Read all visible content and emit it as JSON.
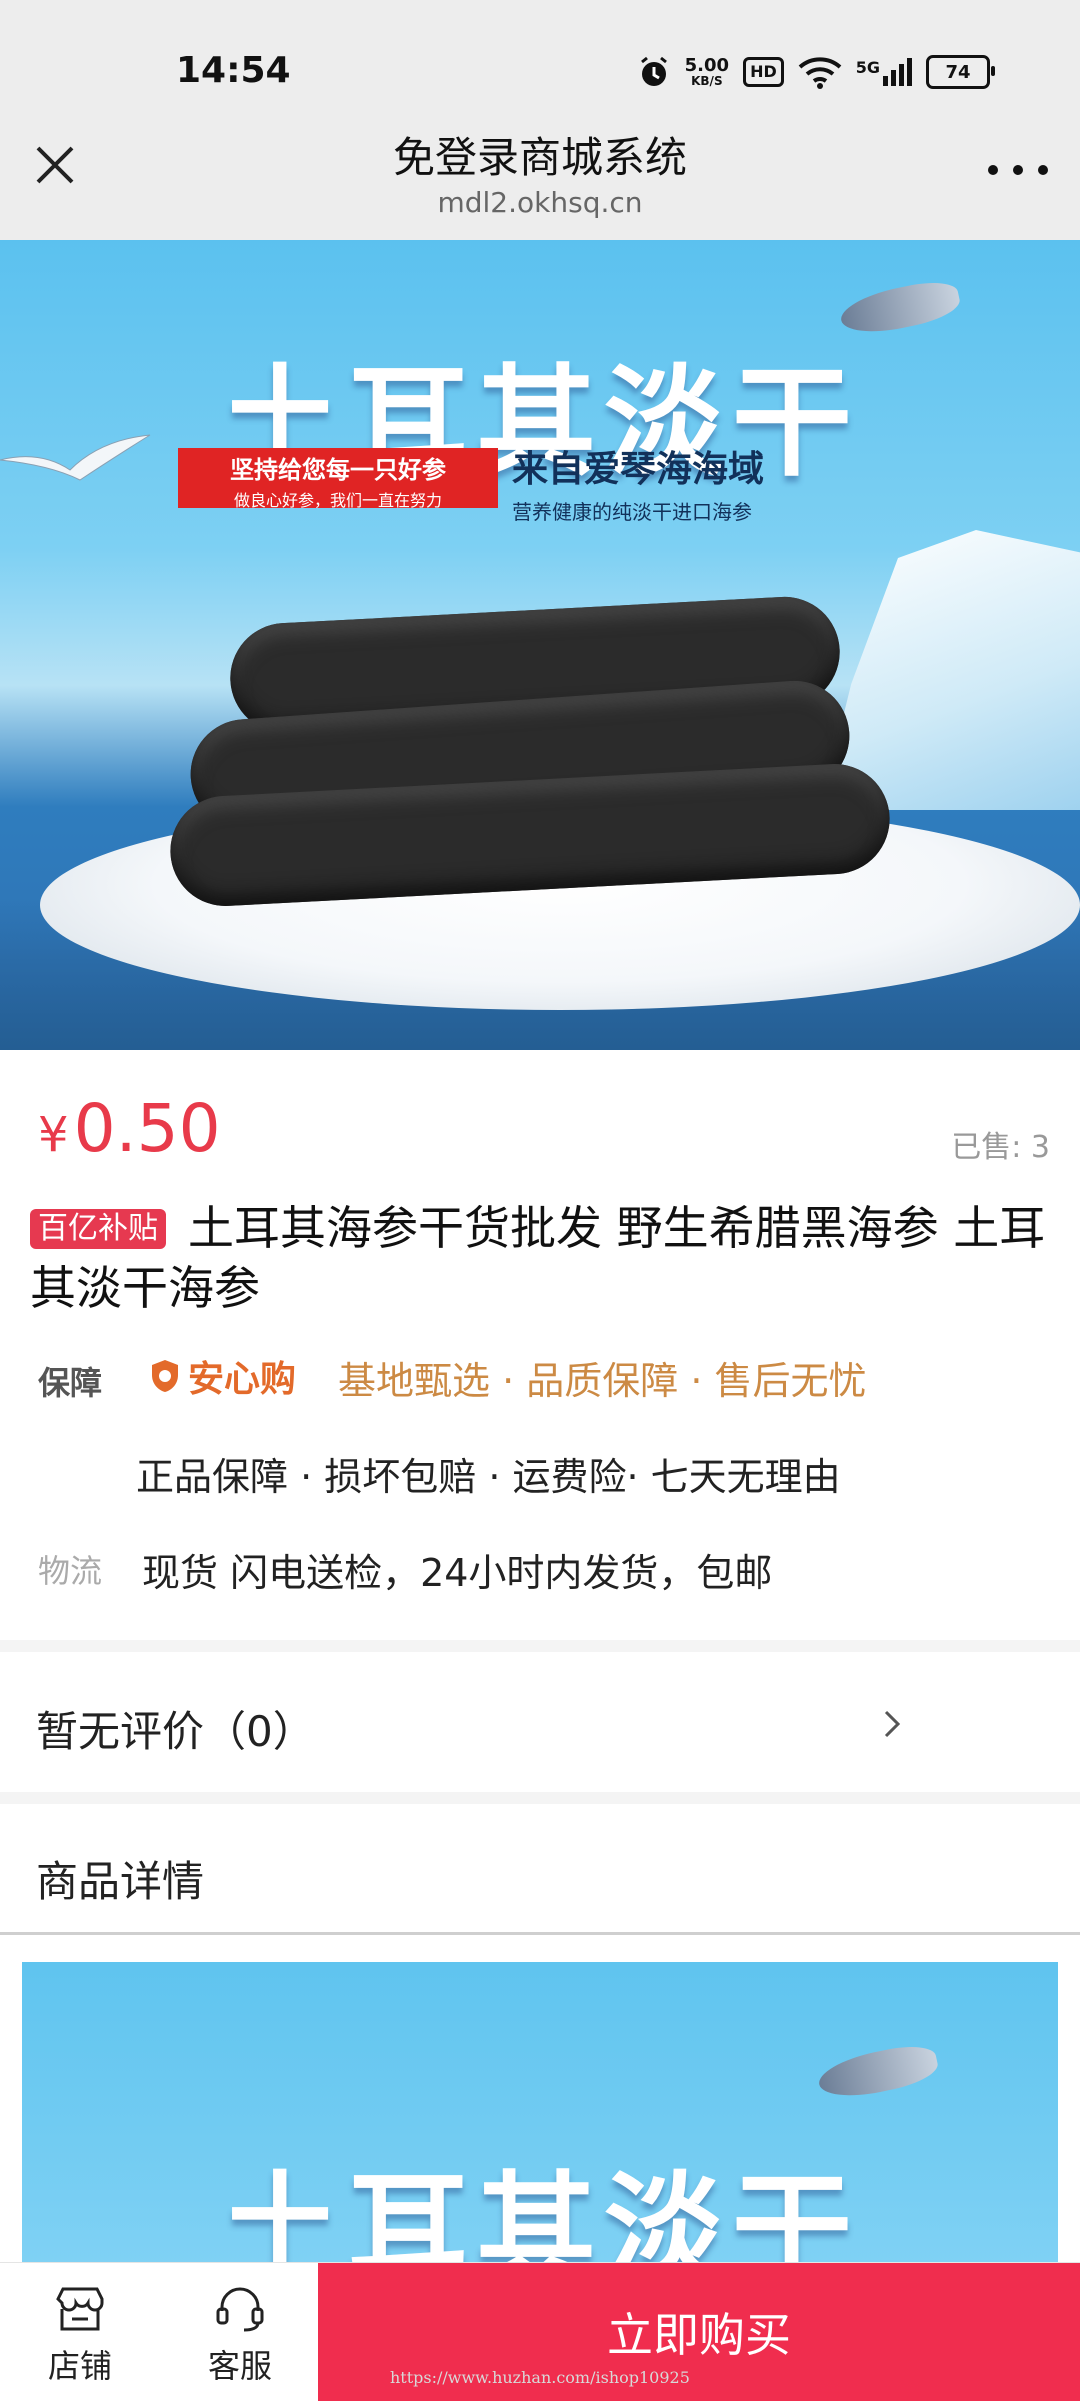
{
  "status_bar": {
    "time": "14:54",
    "net_speed_value": "5.00",
    "net_speed_unit": "KB/S",
    "hd": "HD",
    "signal": "5G",
    "battery": "74"
  },
  "header": {
    "title": "免登录商城系统",
    "url": "mdl2.okhsq.cn"
  },
  "hero": {
    "banner_title": "土耳其淡干",
    "red_tag_line1": "坚持给您每一只好参",
    "red_tag_line2": "做良心好参，我们一直在努力",
    "blue_line1": "来自爱琴海海域",
    "blue_line2": "营养健康的纯淡干进口海参"
  },
  "product": {
    "currency": "¥",
    "price": "0.50",
    "sold": "已售: 3",
    "badge": "百亿补贴",
    "name": "土耳其海参干货批发 野生希腊黑海参 土耳其淡干海参"
  },
  "guarantee": {
    "label": "保障",
    "brand": "安心购",
    "items_line1": "基地甄选 · 品质保障 · 售后无忧",
    "items_line2": "正品保障 · 损坏包赔 · 运费险· 七天无理由"
  },
  "logistics": {
    "label": "物流",
    "value": "现货 闪电送检，24小时内发货，包邮"
  },
  "reviews": {
    "text": "暂无评价（0）"
  },
  "details": {
    "title": "商品详情",
    "image_title": "土耳其淡干"
  },
  "bottom_bar": {
    "store": "店铺",
    "service": "客服",
    "buy": "立即购买"
  },
  "watermark": "https://www.huzhan.com/ishop10925"
}
